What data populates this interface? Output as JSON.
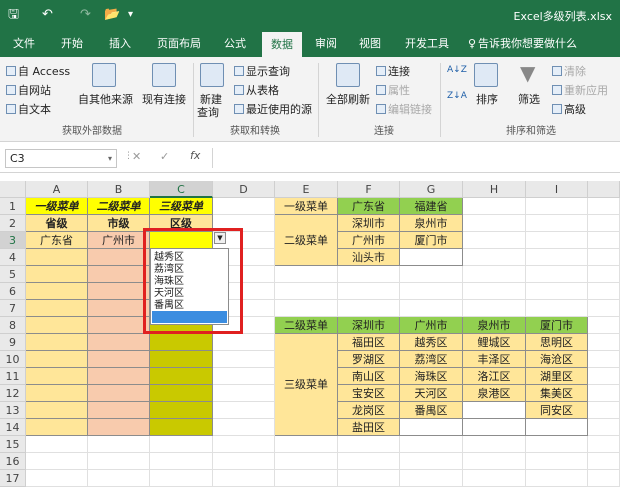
{
  "window": {
    "title": "Excel多级列表.xlsx",
    "qa": {
      "save": "🖫",
      "undo": "↶",
      "redo": "↷",
      "folder": "📂",
      "more": "▾"
    }
  },
  "tabs": [
    {
      "label": "文件"
    },
    {
      "label": "开始"
    },
    {
      "label": "插入"
    },
    {
      "label": "页面布局"
    },
    {
      "label": "公式"
    },
    {
      "label": "数据",
      "active": true
    },
    {
      "label": "审阅"
    },
    {
      "label": "视图"
    },
    {
      "label": "开发工具"
    },
    {
      "label": "告诉我你想要做什么"
    }
  ],
  "ribbon": {
    "get_external": {
      "access": "自 Access",
      "web": "自网站",
      "text": "自文本",
      "other": "自其他来源",
      "existing": "现有连接",
      "group": "获取外部数据"
    },
    "get_transform": {
      "new_query": "新建",
      "new_query2": "查询",
      "show_queries": "显示查询",
      "from_table": "从表格",
      "recent": "最近使用的源",
      "group": "获取和转换"
    },
    "connections": {
      "refresh_all": "全部刷新",
      "connections": "连接",
      "properties": "属性",
      "edit_links": "编辑链接",
      "group": "连接"
    },
    "sort_filter": {
      "sort": "排序",
      "filter": "筛选",
      "clear": "清除",
      "reapply": "重新应用",
      "advanced": "高级",
      "group": "排序和筛选"
    }
  },
  "namebox": "C3",
  "formula_bar": {
    "cancel": "✕",
    "confirm": "✓",
    "fx": "fx",
    "value": ""
  },
  "columns": [
    "A",
    "B",
    "C",
    "D",
    "E",
    "F",
    "G",
    "H",
    "I"
  ],
  "rows": [
    "1",
    "2",
    "3",
    "4",
    "5",
    "6",
    "7",
    "8",
    "9",
    "10",
    "11",
    "12",
    "13",
    "14",
    "15",
    "16",
    "17"
  ],
  "cells": {
    "A1": "一级菜单",
    "B1": "二级菜单",
    "C1": "三级菜单",
    "A2": "省级",
    "B2": "市级",
    "C2": "区级",
    "A3": "广东省",
    "B3": "广州市",
    "E1": "一级菜单",
    "F1": "广东省",
    "G1": "福建省",
    "E2": "二级菜单",
    "F2": "深圳市",
    "G2": "泉州市",
    "F3": "广州市",
    "G3": "厦门市",
    "F4": "汕头市",
    "E8": "二级菜单",
    "F8": "深圳市",
    "G8": "广州市",
    "H8": "泉州市",
    "I8": "厦门市",
    "E10": "三级菜单",
    "F9": "福田区",
    "G9": "越秀区",
    "H9": "鲤城区",
    "I9": "思明区",
    "F10": "罗湖区",
    "G10": "荔湾区",
    "H10": "丰泽区",
    "I10": "海沧区",
    "F11": "南山区",
    "G11": "海珠区",
    "H11": "洛江区",
    "I11": "湖里区",
    "F12": "宝安区",
    "G12": "天河区",
    "H12": "泉港区",
    "I12": "集美区",
    "F13": "龙岗区",
    "G13": "番禺区",
    "I13": "同安区",
    "F14": "盐田区"
  },
  "dropdown": {
    "items": [
      "越秀区",
      "荔湾区",
      "海珠区",
      "天河区",
      "番禺区"
    ]
  }
}
